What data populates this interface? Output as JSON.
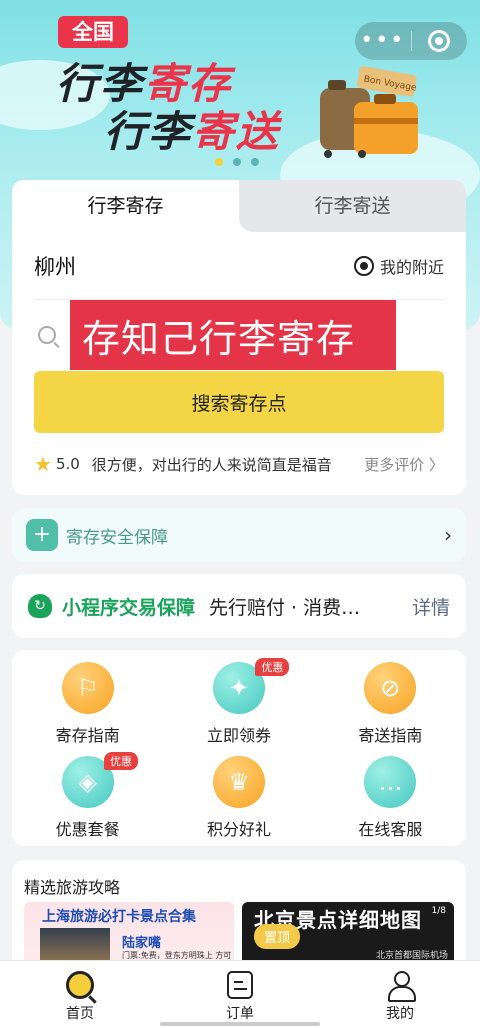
{
  "banner": {
    "badge": "全国",
    "line1_dark": "行李",
    "line1_red": "寄存",
    "line2_dark": "行李",
    "line2_red": "寄送",
    "luggage_text": "Bon Voyage"
  },
  "capsule": {
    "more": "•••"
  },
  "tabs": [
    {
      "label": "行李寄存"
    },
    {
      "label": "行李寄送"
    }
  ],
  "location": {
    "city": "柳州",
    "nearby_label": "我的附近"
  },
  "search": {
    "value": "存知己行李寄存",
    "button_label": "搜索寄存点"
  },
  "review": {
    "score": "5.0",
    "text": "很方便，对出行的人来说简直是福音",
    "more_label": "更多评价 〉"
  },
  "safety": {
    "label": "寄存安全保障"
  },
  "guarantee": {
    "title": "小程序交易保障",
    "desc": "先行赔付 · 消费…",
    "detail_label": "详情"
  },
  "services": [
    {
      "label": "寄存指南",
      "icon": "signpost-icon",
      "badge": ""
    },
    {
      "label": "立即领券",
      "icon": "coupon-icon",
      "badge": "优惠"
    },
    {
      "label": "寄送指南",
      "icon": "compass-icon",
      "badge": ""
    },
    {
      "label": "优惠套餐",
      "icon": "tag-icon",
      "badge": "优惠"
    },
    {
      "label": "积分好礼",
      "icon": "crown-icon",
      "badge": ""
    },
    {
      "label": "在线客服",
      "icon": "chat-icon",
      "badge": ""
    }
  ],
  "guides": {
    "title": "精选旅游攻略",
    "card1_title": "上海旅游必打卡景点合集",
    "card1_place": "陆家嘴",
    "card1_sub": "门票:免费，登东方明珠上 方可 免费",
    "card2_title": "北京景点详细地图",
    "card2_pin": "置顶",
    "card2_counter": "1/8",
    "card2_airport": "北京首都国际机场"
  },
  "tabbar": [
    {
      "label": "首页"
    },
    {
      "label": "订单"
    },
    {
      "label": "我的"
    }
  ],
  "colors": {
    "accent_yellow": "#f3d545",
    "brand_red": "#e43448",
    "guarantee_green": "#19a45a"
  }
}
